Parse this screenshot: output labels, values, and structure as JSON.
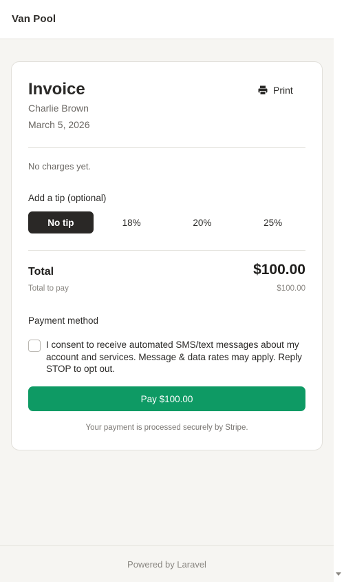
{
  "app": {
    "brand": "Van Pool"
  },
  "invoice": {
    "title": "Invoice",
    "customer": "Charlie Brown",
    "date": "March 5, 2026",
    "print_label": "Print",
    "no_charges": "No charges yet."
  },
  "tip": {
    "label": "Add a tip (optional)",
    "options": [
      "No tip",
      "18%",
      "20%",
      "25%"
    ],
    "selected": "No tip"
  },
  "totals": {
    "total_label": "Total",
    "total_amount": "$100.00",
    "to_pay_label": "Total to pay",
    "to_pay_amount": "$100.00"
  },
  "payment": {
    "method_label": "Payment method",
    "consent_text": "I consent to receive automated SMS/text messages about my account and services. Message & data rates may apply. Reply STOP to opt out.",
    "consent_checked": false,
    "pay_button": "Pay $100.00",
    "secure_note": "Your payment is processed securely by Stripe."
  },
  "footer": {
    "text": "Powered by Laravel"
  },
  "colors": {
    "accent": "#0e9a64",
    "selected_tip": "#2a2826",
    "background": "#f6f5f2"
  },
  "icons": {
    "print": "printer-icon"
  }
}
